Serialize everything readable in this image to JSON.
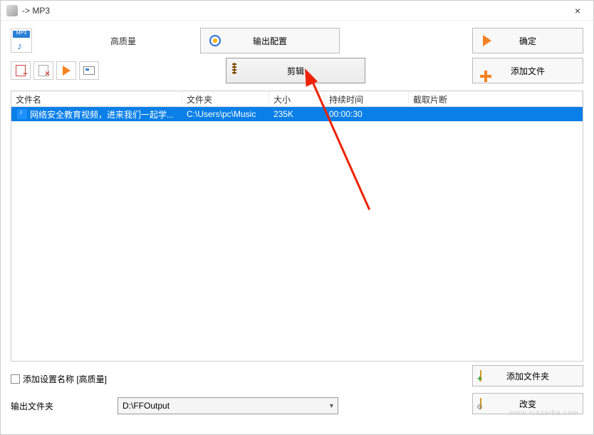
{
  "title": "-> MP3",
  "quality_label": "高质量",
  "buttons": {
    "output_config": "输出配置",
    "ok": "确定",
    "edit": "剪辑",
    "add_file": "添加文件",
    "add_folder": "添加文件夹",
    "change": "改变"
  },
  "table": {
    "headers": {
      "filename": "文件名",
      "folder": "文件夹",
      "size": "大小",
      "duration": "持续时间",
      "clip": "截取片断"
    },
    "rows": [
      {
        "filename": "网络安全教育视频，进来我们一起学...",
        "folder": "C:\\Users\\pc\\Music",
        "size": "235K",
        "duration": "00:00:30",
        "clip": ""
      }
    ]
  },
  "footer": {
    "add_setting_label": "添加设置名称 [高质量]",
    "output_folder_label": "输出文件夹",
    "output_folder_path": "D:\\FFOutput"
  },
  "watermark": "www.xiazaiba.com"
}
